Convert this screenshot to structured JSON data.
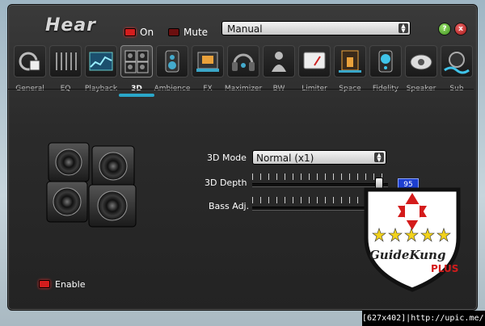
{
  "app": {
    "title": "Hear"
  },
  "toolbar": {
    "on_label": "On",
    "mute_label": "Mute",
    "preset_value": "Manual",
    "help_icon": "?",
    "close_icon": "x"
  },
  "tabs": [
    {
      "label": "General",
      "icon": "general-icon"
    },
    {
      "label": "EQ",
      "icon": "eq-icon"
    },
    {
      "label": "Playback",
      "icon": "playback-icon"
    },
    {
      "label": "3D",
      "icon": "speakers-3d-icon",
      "active": true
    },
    {
      "label": "Ambience",
      "icon": "ambience-icon"
    },
    {
      "label": "FX",
      "icon": "fx-icon"
    },
    {
      "label": "Maximizer",
      "icon": "headphones-icon"
    },
    {
      "label": "BW",
      "icon": "bw-icon"
    },
    {
      "label": "Limiter",
      "icon": "limiter-gauge-icon"
    },
    {
      "label": "Space",
      "icon": "space-icon"
    },
    {
      "label": "Fidelity",
      "icon": "fidelity-icon"
    },
    {
      "label": "Speaker",
      "icon": "speaker-icon"
    },
    {
      "label": "Sub",
      "icon": "sub-icon"
    }
  ],
  "panel_3d": {
    "mode_label": "3D Mode",
    "mode_value": "Normal  (x1)",
    "depth_label": "3D Depth",
    "depth_value": "95",
    "bass_label": "Bass Adj.",
    "enable_label": "Enable"
  },
  "watermark": {
    "text": "GuideKung PLUS"
  },
  "footer": {
    "text": "[627x402]|http://upic.me/"
  },
  "colors": {
    "accent": "#2aa7c9",
    "led_on": "#d31d1d",
    "value_box": "#1d3fd0"
  }
}
